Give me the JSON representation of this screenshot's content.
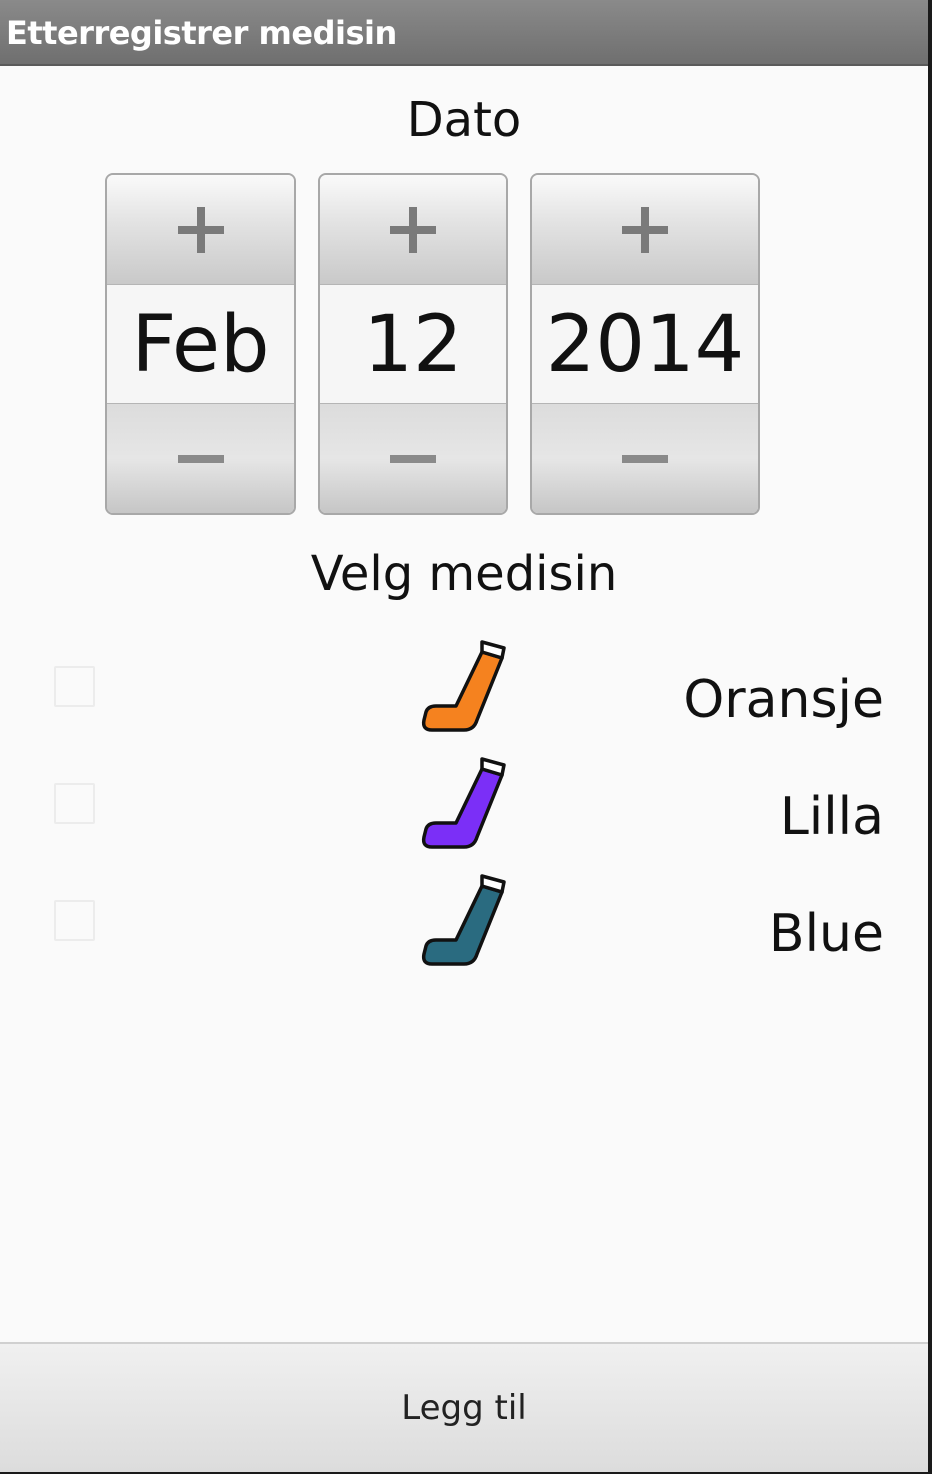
{
  "window": {
    "title": "Etterregistrer medisin"
  },
  "date_section": {
    "label": "Dato",
    "month": "Feb",
    "day": "12",
    "year": "2014"
  },
  "medicine_section": {
    "label": "Velg medisin",
    "items": [
      {
        "name": "Oransje",
        "color": "#f5821f",
        "checked": false
      },
      {
        "name": "Lilla",
        "color": "#7b2ff7",
        "checked": false
      },
      {
        "name": "Blue",
        "color": "#2a6b80",
        "checked": false
      }
    ]
  },
  "footer": {
    "add_label": "Legg til"
  },
  "icons": {
    "increment": "plus-icon",
    "decrement": "minus-icon",
    "medicine": "inhaler-icon"
  }
}
